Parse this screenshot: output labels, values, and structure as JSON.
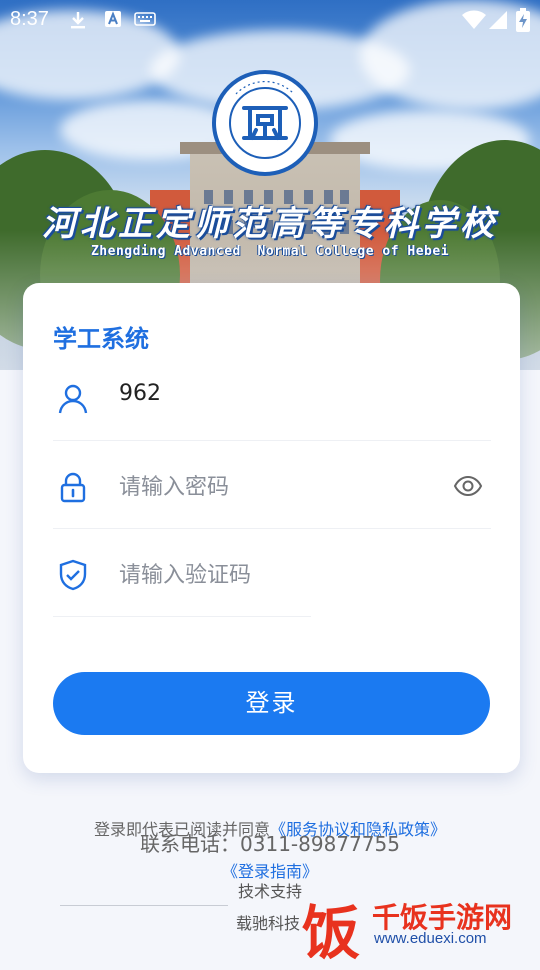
{
  "status_bar": {
    "time": "8:37",
    "icons": [
      "download-icon",
      "a-badge-icon",
      "keyboard-icon",
      "wifi-icon",
      "signal-icon",
      "battery-charging-icon"
    ]
  },
  "header": {
    "school_name_cn": "河北正定师范高等专科学校",
    "school_name_en": "Zhengding Advanced  Normal College of Hebei"
  },
  "login_card": {
    "title": "学工系统",
    "username": {
      "value": "962",
      "icon": "user-icon"
    },
    "password": {
      "placeholder": "请输入密码",
      "icon": "lock-icon",
      "toggle_icon": "eye-icon"
    },
    "captcha": {
      "placeholder": "请输入验证码",
      "icon": "shield-check-icon"
    },
    "login_button": "登录"
  },
  "footer": {
    "agreement_prefix": "登录即代表已阅读并同意",
    "agreement_link": "《服务协议和隐私政策》",
    "phone": "联系电话：0311-89877755",
    "guide_link": "《登录指南》",
    "support": "技术支持",
    "company": "载驰科技"
  },
  "watermark": {
    "glyph": "饭",
    "brand": "千饭手游网",
    "url": "www.eduexi.com"
  },
  "colors": {
    "accent": "#1b7af1",
    "link": "#1f6fe0",
    "logo_blue": "#1d5fb8"
  }
}
